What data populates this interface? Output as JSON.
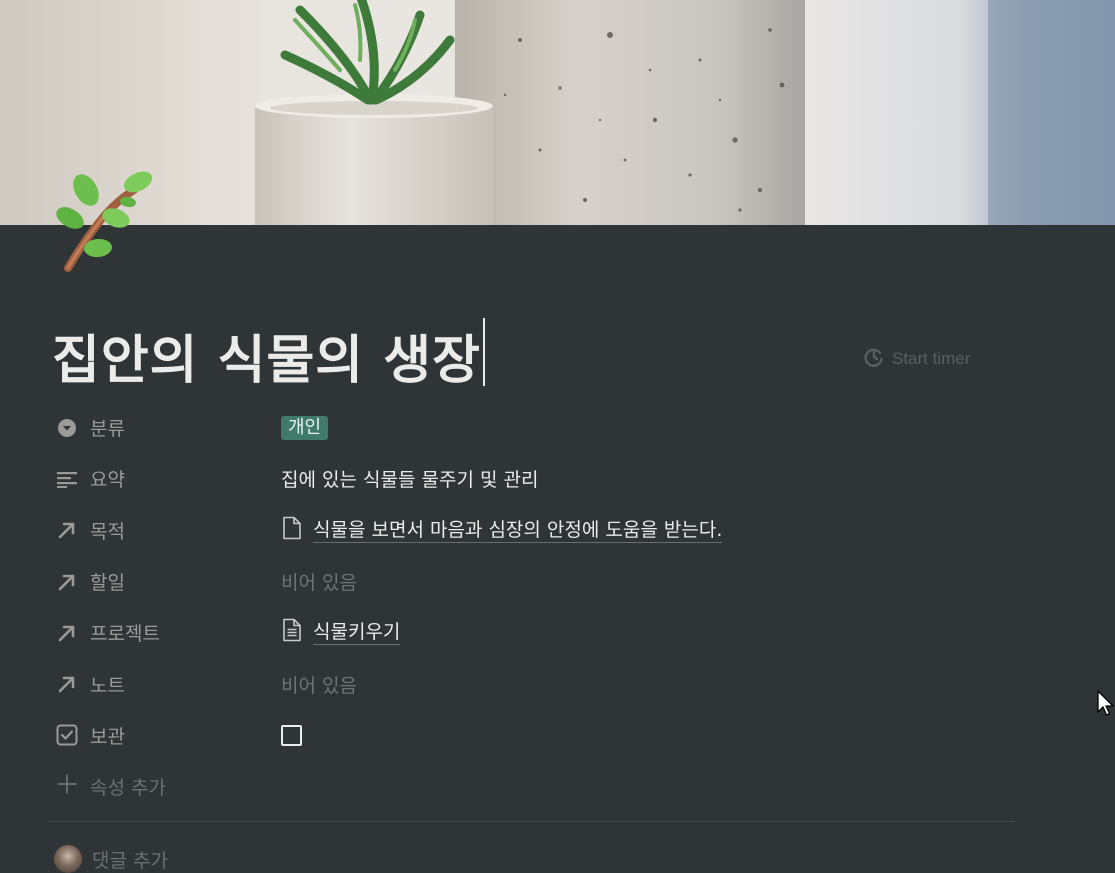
{
  "page": {
    "title": "집안의 식물의 생장",
    "icon": "herb-branch-icon",
    "start_timer_label": "Start timer"
  },
  "properties": [
    {
      "name": "분류",
      "icon": "select-icon",
      "type": "select",
      "value": "개인",
      "tag_color": "#3f7a6b"
    },
    {
      "name": "요약",
      "icon": "text-lines-icon",
      "type": "text",
      "value": "집에 있는 식물들 물주기 및 관리"
    },
    {
      "name": "목적",
      "icon": "relation-arrow-icon",
      "type": "relation",
      "value": "식물을 보면서 마음과 심장의 안정에 도움을 받는다.",
      "page_icon": "blank-page-icon"
    },
    {
      "name": "할일",
      "icon": "relation-arrow-icon",
      "type": "relation",
      "value": "비어 있음",
      "empty": true
    },
    {
      "name": "프로젝트",
      "icon": "relation-arrow-icon",
      "type": "relation",
      "value": "식물키우기",
      "page_icon": "text-page-icon"
    },
    {
      "name": "노트",
      "icon": "relation-arrow-icon",
      "type": "relation",
      "value": "비어 있음",
      "empty": true
    },
    {
      "name": "보관",
      "icon": "checkbox-icon",
      "type": "checkbox",
      "checked": false
    }
  ],
  "add_property_label": "속성 추가",
  "comment": {
    "placeholder": "댓글 추가"
  },
  "colors": {
    "background": "#2f3437",
    "text": "#ebebea",
    "muted": "#9b9a97",
    "tag": "#3f7a6b"
  }
}
